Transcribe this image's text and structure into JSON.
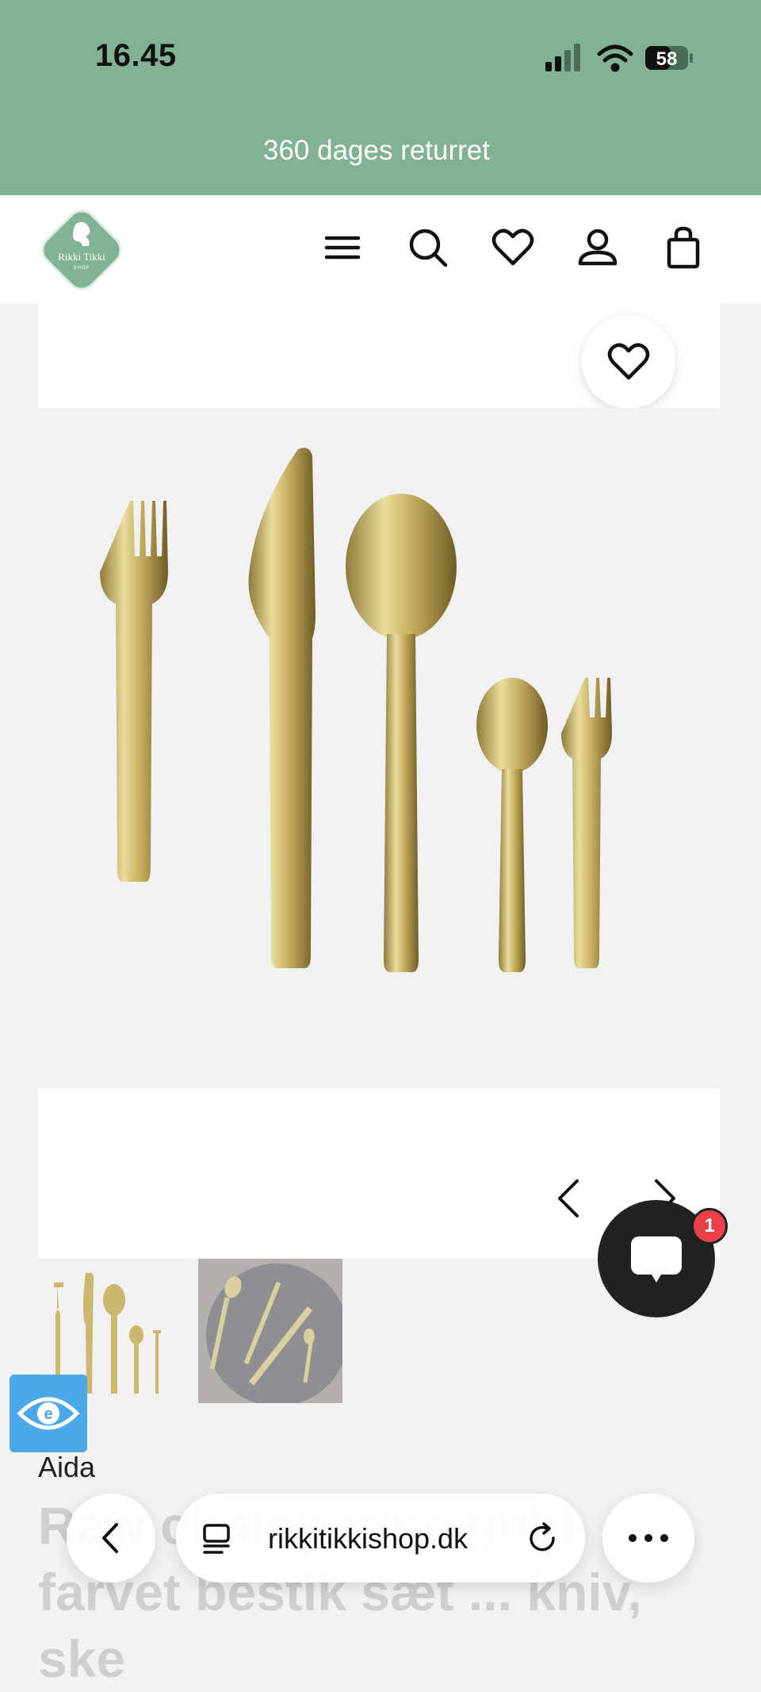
{
  "status_bar": {
    "time": "16.45",
    "battery": "58"
  },
  "promo": {
    "text": "360 dages returret"
  },
  "header": {
    "logo_text": "Rikki Tikki",
    "logo_subtext": "SHOP",
    "icons": [
      "menu-icon",
      "search-icon",
      "heart-icon",
      "account-icon",
      "bag-icon"
    ]
  },
  "gallery": {
    "thumbnails": [
      "cutlery-set-white",
      "cutlery-on-plate"
    ],
    "main_image": "gold cutlery set"
  },
  "chat": {
    "badge": "1"
  },
  "product": {
    "brand": "Aida",
    "title": "Raw champagne guld farvet bestik sæt ... kniv, ske"
  },
  "browser": {
    "url": "rikkitikkishop.dk"
  },
  "colors": {
    "banner": "#80b293",
    "chat_bg": "#222222",
    "badge": "#e84248",
    "accessibility": "#4aa8e6"
  }
}
